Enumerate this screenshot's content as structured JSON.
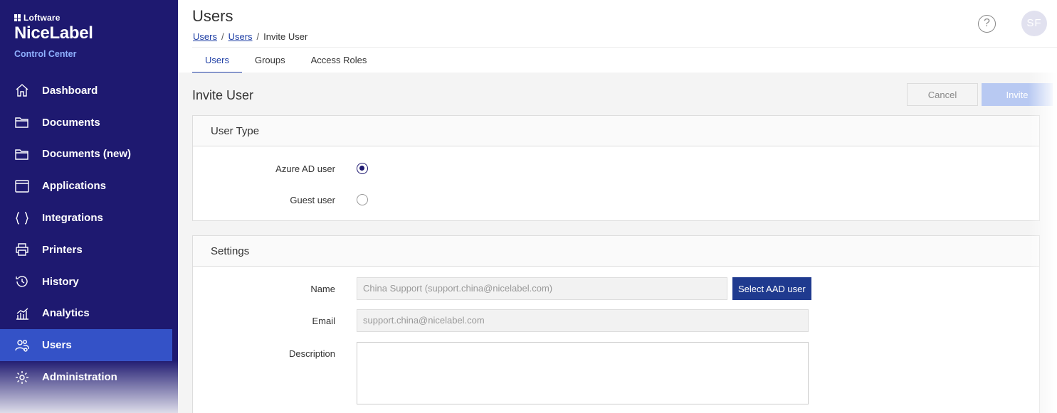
{
  "brand": {
    "company": "Loftware",
    "product": "NiceLabel",
    "subtitle": "Control Center"
  },
  "sidebar": {
    "items": [
      {
        "label": "Dashboard",
        "icon": "home-icon"
      },
      {
        "label": "Documents",
        "icon": "folder-icon"
      },
      {
        "label": "Documents (new)",
        "icon": "folder-icon"
      },
      {
        "label": "Applications",
        "icon": "window-icon"
      },
      {
        "label": "Integrations",
        "icon": "braces-icon"
      },
      {
        "label": "Printers",
        "icon": "printer-icon"
      },
      {
        "label": "History",
        "icon": "history-icon"
      },
      {
        "label": "Analytics",
        "icon": "analytics-icon"
      },
      {
        "label": "Users",
        "icon": "users-icon",
        "active": true
      },
      {
        "label": "Administration",
        "icon": "gear-icon"
      }
    ]
  },
  "header": {
    "title": "Users",
    "breadcrumb": {
      "link1": "Users",
      "link2": "Users",
      "current": "Invite User"
    },
    "help_symbol": "?",
    "avatar_initials": "SF"
  },
  "tabs": [
    {
      "label": "Users",
      "active": true
    },
    {
      "label": "Groups"
    },
    {
      "label": "Access Roles"
    }
  ],
  "page": {
    "title": "Invite User",
    "cancel_label": "Cancel",
    "invite_label": "Invite"
  },
  "user_type": {
    "heading": "User Type",
    "options": [
      {
        "label": "Azure AD user",
        "checked": true
      },
      {
        "label": "Guest user",
        "checked": false
      }
    ]
  },
  "settings": {
    "heading": "Settings",
    "name_label": "Name",
    "name_value": "China Support (support.china@nicelabel.com)",
    "select_aad_label": "Select AAD user",
    "email_label": "Email",
    "email_value": "support.china@nicelabel.com",
    "description_label": "Description",
    "description_value": ""
  },
  "colors": {
    "sidebar_bg": "#1e1970",
    "active_item": "#3452c7",
    "accent": "#1f3fa5"
  }
}
